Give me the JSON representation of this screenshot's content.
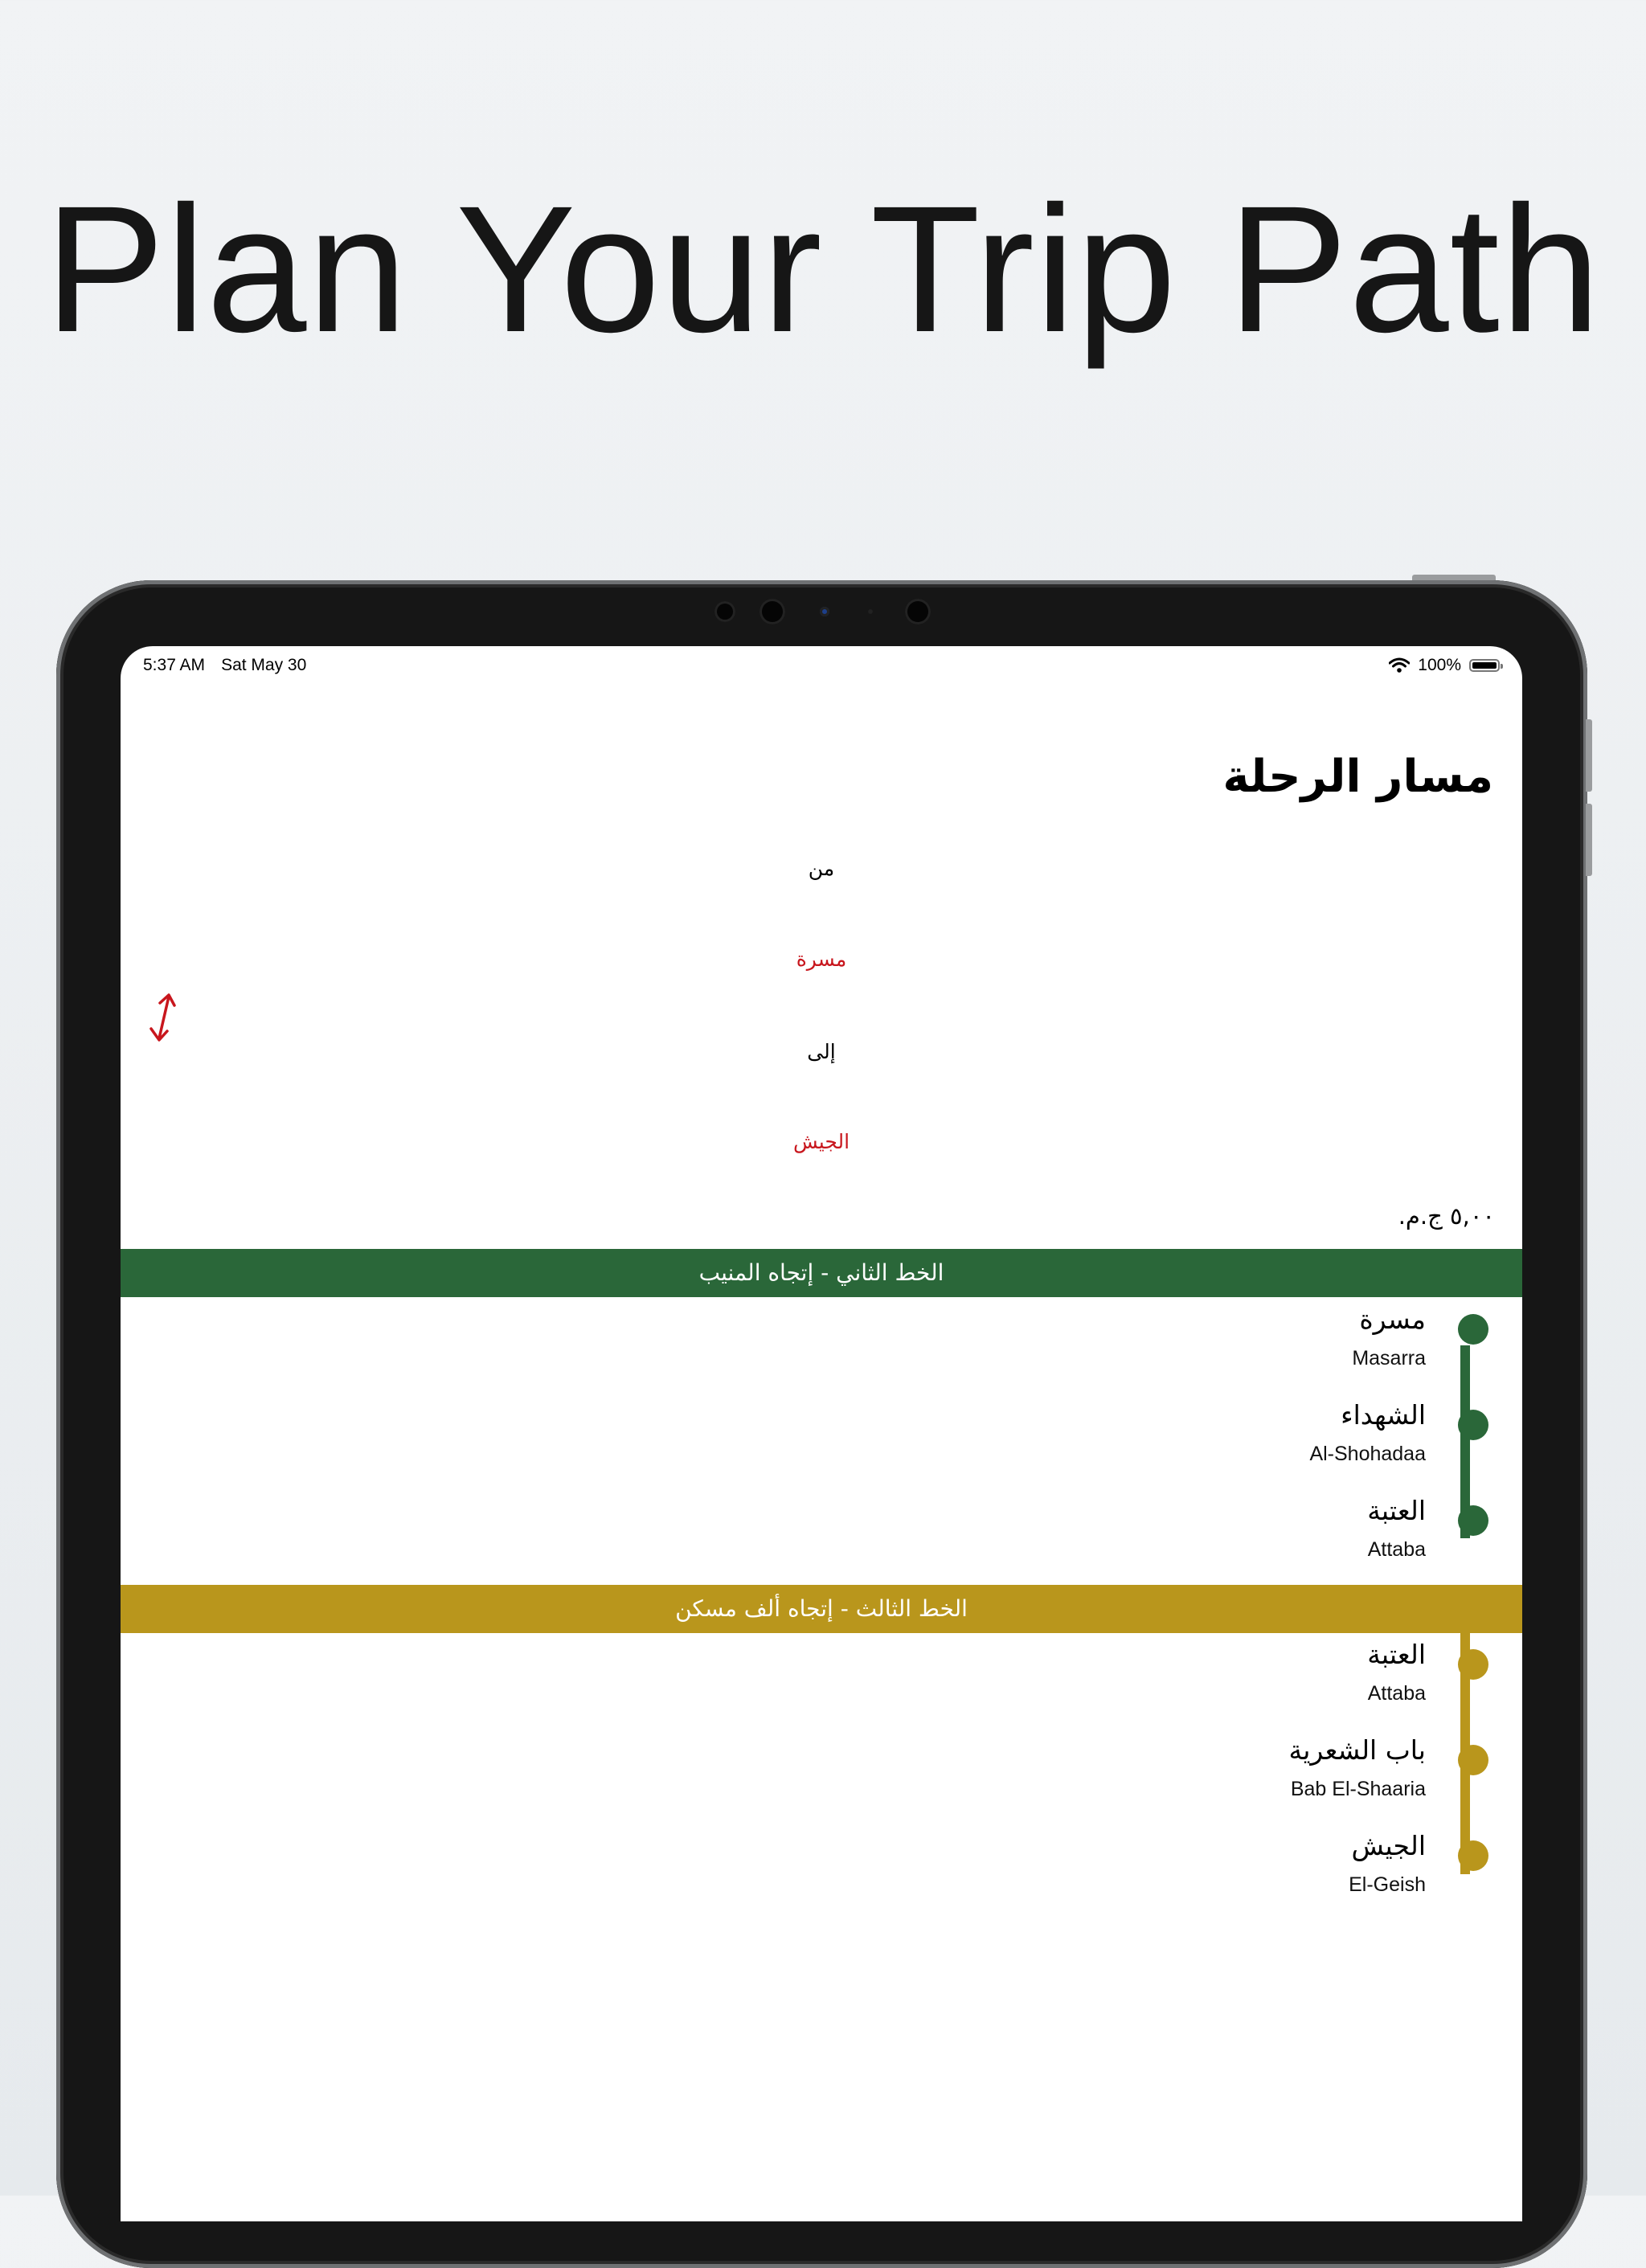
{
  "headline": "Plan Your Trip Path",
  "status_bar": {
    "time": "5:37 AM",
    "date": "Sat May 30",
    "battery": "100%"
  },
  "page_title": "مسار الرحلة",
  "from_label": "من",
  "from_station": "مسرة",
  "to_label": "إلى",
  "to_station": "الجيش",
  "fare": "٥,٠٠ ج.م.",
  "colors": {
    "red": "#c8161d",
    "line2": "#2a6739",
    "line3": "#b9961c"
  },
  "segments": [
    {
      "header": "الخط الثاني - إتجاه المنيب",
      "stops": [
        {
          "ar": "مسرة",
          "en": "Masarra"
        },
        {
          "ar": "الشهداء",
          "en": "Al-Shohadaa"
        },
        {
          "ar": "العتبة",
          "en": "Attaba"
        }
      ]
    },
    {
      "header": "الخط الثالث - إتجاه ألف مسكن",
      "stops": [
        {
          "ar": "العتبة",
          "en": "Attaba"
        },
        {
          "ar": "باب الشعرية",
          "en": "Bab El-Shaaria"
        },
        {
          "ar": "الجيش",
          "en": "El-Geish"
        }
      ]
    }
  ]
}
